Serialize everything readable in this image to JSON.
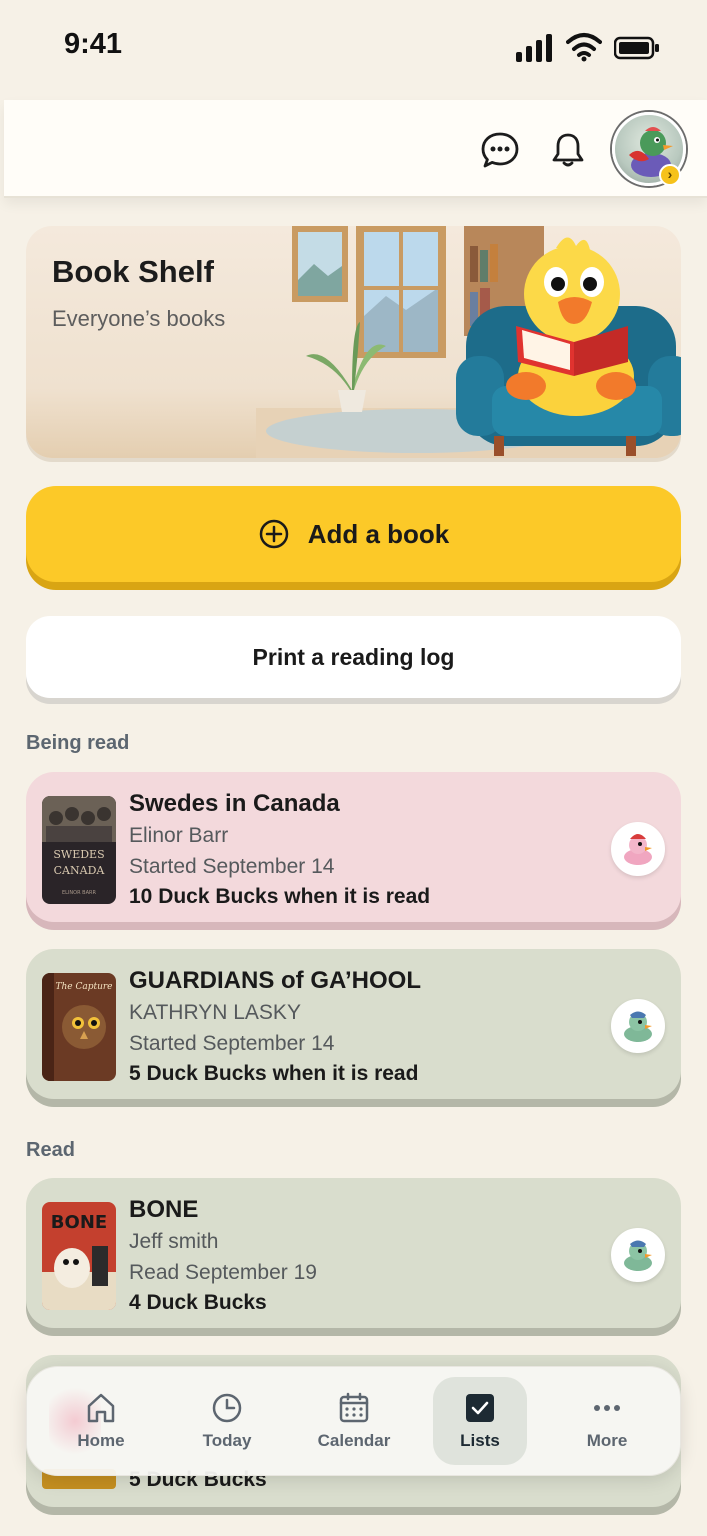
{
  "status_bar": {
    "time": "9:41"
  },
  "hero": {
    "title": "Book Shelf",
    "subtitle": "Everyone’s books"
  },
  "actions": {
    "add_book": "Add a book",
    "print_log": "Print a reading log"
  },
  "sections": {
    "being_read": "Being read",
    "read": "Read"
  },
  "books_being_read": [
    {
      "title": "Swedes in Canada",
      "author": "Elinor Barr",
      "date": "Started September 14",
      "reward": "10 Duck Bucks when it is read",
      "color": "#f3d9dc"
    },
    {
      "title": "GUARDIANS of GA’HOOL",
      "author": "KATHRYN LASKY",
      "date": "Started September 14",
      "reward": "5 Duck Bucks when it is read",
      "color": "#d9ddcd"
    }
  ],
  "books_read": [
    {
      "title": "BONE",
      "author": "Jeff smith",
      "date": "Read September 19",
      "reward": "4 Duck Bucks",
      "color": "#d9ddcd"
    },
    {
      "reward": "5 Duck Bucks"
    }
  ],
  "cover_text": {
    "swedes_line1": "SWEDES",
    "swedes_line2": "CANADA",
    "swedes_author": "ELINOR BARR",
    "guardians_sub": "The Capture",
    "bone_title": "BONE"
  },
  "tab_bar": {
    "tabs": [
      {
        "label": "Home",
        "icon": "home-icon"
      },
      {
        "label": "Today",
        "icon": "clock-icon"
      },
      {
        "label": "Calendar",
        "icon": "calendar-icon"
      },
      {
        "label": "Lists",
        "icon": "checkbox-icon",
        "active": true
      },
      {
        "label": "More",
        "icon": "more-icon"
      }
    ]
  },
  "colors": {
    "accent_yellow": "#fcc928",
    "background": "#f6f1e7",
    "pink_card": "#f3d9dc",
    "green_card": "#d9ddcd"
  }
}
